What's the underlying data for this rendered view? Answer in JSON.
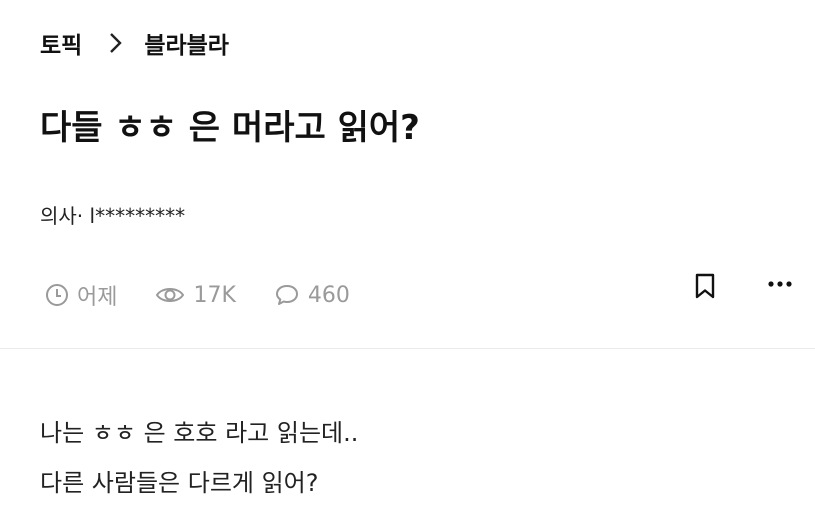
{
  "breadcrumb": {
    "topic": "토픽",
    "current": "블라블라"
  },
  "post": {
    "title": "다들 ㅎㅎ 은 머라고 읽어?",
    "author": "의사· l*********",
    "time": "어제",
    "views": "17K",
    "comments": "460",
    "body": [
      "나는 ㅎㅎ 은 호호 라고 읽는데..",
      "다른 사람들은 다르게 읽어?"
    ]
  },
  "icons": {
    "time": "clock-icon",
    "views": "eye-icon",
    "comments": "comment-icon",
    "bookmark": "bookmark-icon",
    "more": "more-icon"
  },
  "colors": {
    "text": "#111111",
    "meta": "#9a9a9a",
    "divider": "#ebebeb"
  }
}
